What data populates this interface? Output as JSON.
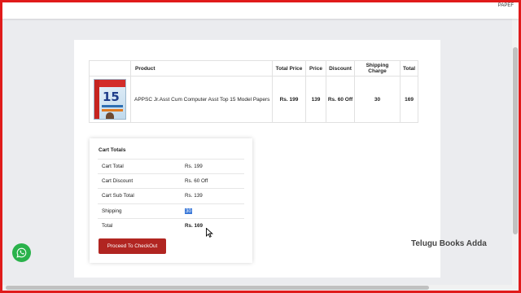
{
  "topbar": {
    "text": "PAPEF"
  },
  "cart_table": {
    "headers": [
      "",
      "Product",
      "Total Price",
      "Price",
      "Discount",
      "Shipping Charge",
      "Total"
    ],
    "rows": [
      {
        "thumbnail_alt": "15",
        "product": "APPSC Jr.Asst Cum Computer Asst Top 15 Model Papers",
        "total_price": "Rs. 199",
        "price": "139",
        "discount": "Rs. 60 Off",
        "shipping_charge": "30",
        "total": "169"
      }
    ]
  },
  "cart_totals": {
    "title": "Cart Totals",
    "rows": [
      {
        "label": "Cart Total",
        "value": "Rs. 199"
      },
      {
        "label": "Cart Discount",
        "value": "Rs. 60 Off"
      },
      {
        "label": "Cart Sub Total",
        "value": "Rs. 139"
      },
      {
        "label": "Shipping",
        "value": "30"
      },
      {
        "label": "Total",
        "value": "Rs. 169"
      }
    ],
    "checkout_label": "Proceed To CheckOut"
  },
  "brand": "Telugu Books Adda",
  "icons": {
    "chat": "whatsapp-icon"
  },
  "colors": {
    "frame": "#e01b1b",
    "button": "#b12521",
    "whatsapp": "#2ab24b",
    "selection": "#3a78d8"
  }
}
